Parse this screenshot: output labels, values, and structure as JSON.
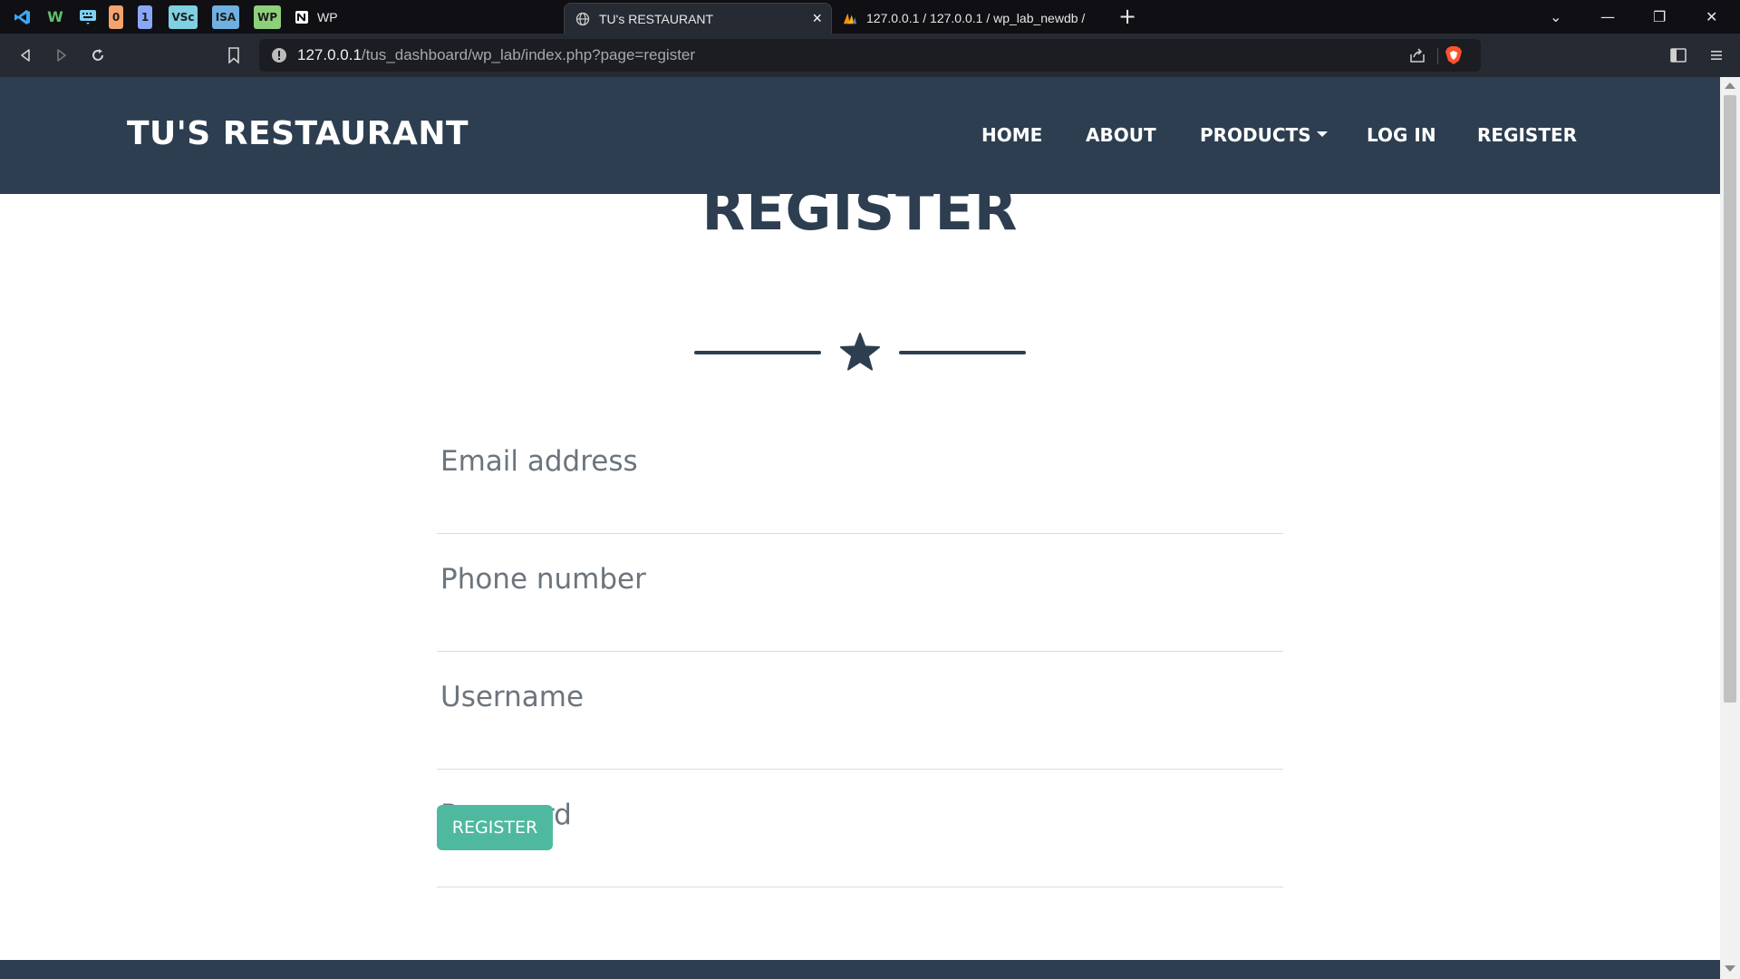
{
  "browser": {
    "pinned_tabs": [
      {
        "name": "vscode-icon",
        "text": ""
      },
      {
        "name": "webstorm-icon",
        "text": "W"
      },
      {
        "name": "keyboard-icon",
        "text": ""
      },
      {
        "name": "pinned-0",
        "text": "0",
        "color": "#f4a36c"
      },
      {
        "name": "pinned-1",
        "text": "1",
        "color": "#8aa7f5"
      },
      {
        "name": "pinned-vsc",
        "text": "VSc",
        "color": "#7fd0e0"
      },
      {
        "name": "pinned-isa",
        "text": "ISA",
        "color": "#6fb0e0"
      },
      {
        "name": "pinned-wp",
        "text": "WP",
        "color": "#8ed07a"
      }
    ],
    "notion_tab_label": "WP",
    "tabs": [
      {
        "label": "TU's RESTAURANT",
        "active": true,
        "close": "×"
      },
      {
        "label": "127.0.0.1 / 127.0.0.1 / wp_lab_newdb /",
        "active": false
      }
    ],
    "new_tab": "+",
    "window_controls": {
      "dropdown": "⌄",
      "minimize": "—",
      "restore": "❐",
      "close": "✕"
    },
    "url": {
      "host": "127.0.0.1",
      "path": "/tus_dashboard/wp_lab/index.php?page=register"
    }
  },
  "site": {
    "brand": "TU'S RESTAURANT",
    "nav": [
      "HOME",
      "ABOUT",
      "PRODUCTS",
      "LOG IN",
      "REGISTER"
    ],
    "page_title": "REGISTER",
    "form": {
      "email_placeholder": "Email address",
      "phone_placeholder": "Phone number",
      "username_placeholder": "Username",
      "password_placeholder": "Password",
      "submit_label": "REGISTER"
    }
  },
  "colors": {
    "navbar": "#2c3e50",
    "accent": "#4fb99f",
    "brave": "#fb542b"
  }
}
